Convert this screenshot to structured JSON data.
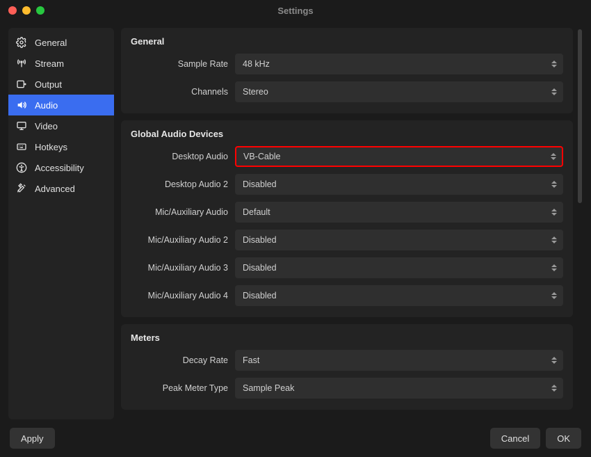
{
  "window": {
    "title": "Settings"
  },
  "sidebar": {
    "items": [
      {
        "label": "General",
        "icon": "gear-icon"
      },
      {
        "label": "Stream",
        "icon": "antenna-icon"
      },
      {
        "label": "Output",
        "icon": "output-icon"
      },
      {
        "label": "Audio",
        "icon": "speaker-icon"
      },
      {
        "label": "Video",
        "icon": "monitor-icon"
      },
      {
        "label": "Hotkeys",
        "icon": "keyboard-icon"
      },
      {
        "label": "Accessibility",
        "icon": "accessibility-icon"
      },
      {
        "label": "Advanced",
        "icon": "tools-icon"
      }
    ],
    "active_index": 3
  },
  "panels": {
    "general": {
      "title": "General",
      "sample_rate": {
        "label": "Sample Rate",
        "value": "48 kHz"
      },
      "channels": {
        "label": "Channels",
        "value": "Stereo"
      }
    },
    "global_audio": {
      "title": "Global Audio Devices",
      "desktop_audio": {
        "label": "Desktop Audio",
        "value": "VB-Cable",
        "highlight": true
      },
      "desktop_audio2": {
        "label": "Desktop Audio 2",
        "value": "Disabled"
      },
      "mic_aux": {
        "label": "Mic/Auxiliary Audio",
        "value": "Default"
      },
      "mic_aux2": {
        "label": "Mic/Auxiliary Audio 2",
        "value": "Disabled"
      },
      "mic_aux3": {
        "label": "Mic/Auxiliary Audio 3",
        "value": "Disabled"
      },
      "mic_aux4": {
        "label": "Mic/Auxiliary Audio 4",
        "value": "Disabled"
      }
    },
    "meters": {
      "title": "Meters",
      "decay_rate": {
        "label": "Decay Rate",
        "value": "Fast"
      },
      "peak_meter_type": {
        "label": "Peak Meter Type",
        "value": "Sample Peak"
      }
    }
  },
  "footer": {
    "apply": "Apply",
    "cancel": "Cancel",
    "ok": "OK"
  }
}
